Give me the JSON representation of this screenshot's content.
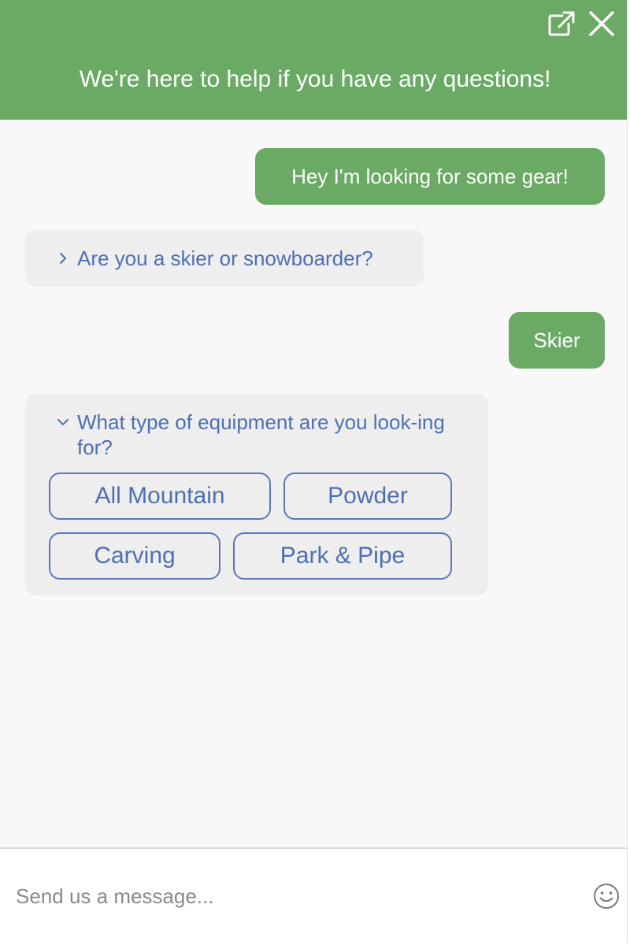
{
  "header": {
    "title": "We're here to help if you have any questions!",
    "popout_icon": "external-link-icon",
    "close_icon": "close-icon",
    "background_color": "#6aaa64"
  },
  "messages": {
    "user_1": "Hey I'm looking for some gear!",
    "bot_1": "Are you a skier or snowboarder?",
    "user_2": "Skier",
    "bot_2": "What type of equipment are you look-ing for?"
  },
  "choices": [
    "All Mountain",
    "Powder",
    "Carving",
    "Park & Pipe"
  ],
  "composer": {
    "placeholder": "Send us a message...",
    "emoji_icon": "smiley-icon"
  },
  "colors": {
    "user_bubble": "#6aaa64",
    "bot_text": "#4e6fb3",
    "choice_border": "#5c78bb"
  }
}
